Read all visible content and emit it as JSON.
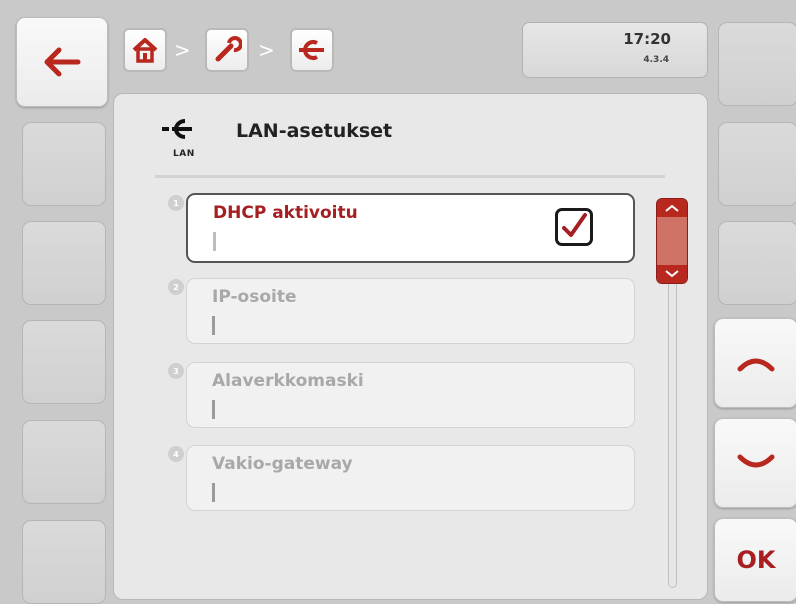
{
  "header": {
    "breadcrumb": [
      {
        "icon": "home-icon"
      },
      {
        "icon": "wrench-icon"
      },
      {
        "icon": "plug-icon"
      }
    ],
    "separator": ">",
    "time": "17:20",
    "version": "4.3.4"
  },
  "main": {
    "title": "LAN-asetukset",
    "title_icon": "plug-icon",
    "title_icon_caption": "LAN",
    "rows": [
      {
        "number": "1",
        "label": "DHCP aktivoitu",
        "checked": true,
        "selected": true
      },
      {
        "number": "2",
        "label": "IP-osoite"
      },
      {
        "number": "3",
        "label": "Alaverkkomaski"
      },
      {
        "number": "4",
        "label": "Vakio-gateway"
      }
    ]
  },
  "right_panel": {
    "ok_label": "OK"
  },
  "colors": {
    "accent_red": "#a51e22",
    "icon_red": "#b8281f",
    "background": "#c9c9c9"
  }
}
